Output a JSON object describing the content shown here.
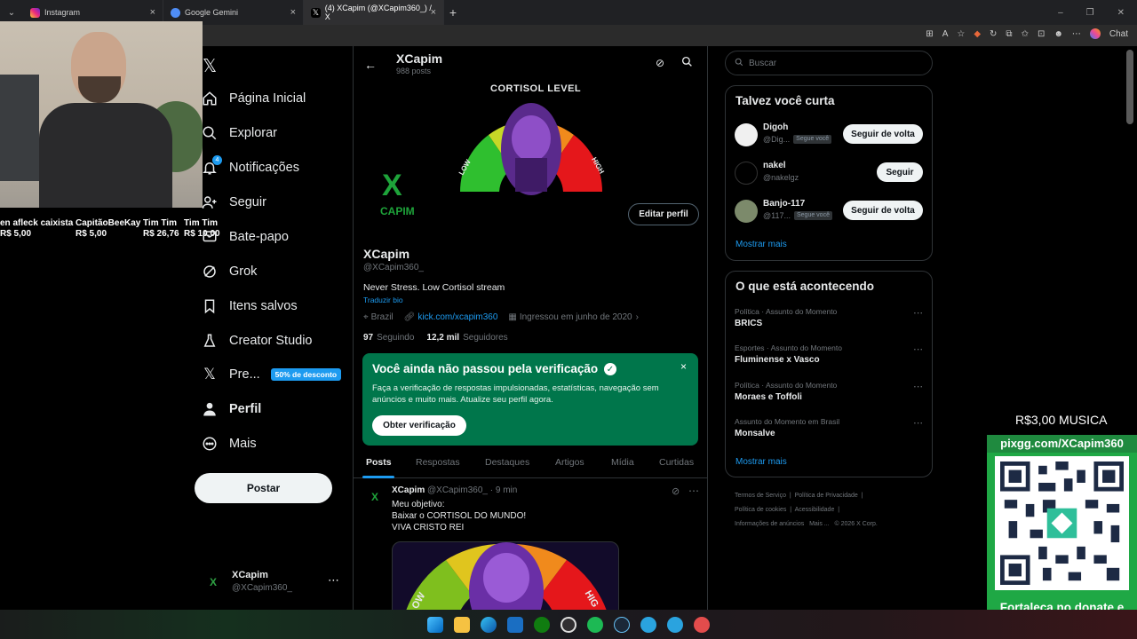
{
  "browser": {
    "tabs": [
      {
        "label": "Instagram",
        "color": "#d62976"
      },
      {
        "label": "Google Gemini",
        "color": "#4f8df5"
      },
      {
        "label": "(4) XCapim (@XCapim360_) / X",
        "color": "#ffffff"
      }
    ],
    "chat_label": "Chat"
  },
  "stream_overlay": {
    "donations": [
      {
        "name": "en afleck caixista",
        "amount": "R$ 5,00"
      },
      {
        "name": "CapitãoBeeKay",
        "amount": "R$ 5,00"
      },
      {
        "name": "Tim Tim",
        "amount": "R$ 26,76"
      },
      {
        "name": "Tim Tim",
        "amount": "R$ 10,00"
      }
    ],
    "music_price": "R$3,00 MUSICA",
    "pix_url": "pixgg.com/XCapim360",
    "donate_message": "Fortaleça no donate e envie sua mensagem!"
  },
  "nav": {
    "items": [
      {
        "label": "Página Inicial",
        "icon": "home-icon"
      },
      {
        "label": "Explorar",
        "icon": "search-icon"
      },
      {
        "label": "Notificações",
        "icon": "bell-icon",
        "badge": "4"
      },
      {
        "label": "Seguir",
        "icon": "person-add-icon"
      },
      {
        "label": "Bate-papo",
        "icon": "chat-icon"
      },
      {
        "label": "Grok",
        "icon": "grok-icon"
      },
      {
        "label": "Itens salvos",
        "icon": "bookmark-icon"
      },
      {
        "label": "Creator Studio",
        "icon": "flask-icon"
      },
      {
        "label": "Pre...",
        "icon": "x-logo-icon",
        "badge": "50% de desconto"
      },
      {
        "label": "Perfil",
        "icon": "profile-icon"
      },
      {
        "label": "Mais",
        "icon": "more-circle-icon"
      }
    ],
    "post_label": "Postar",
    "account": {
      "name": "XCapim",
      "handle": "@XCapim360_"
    }
  },
  "profile": {
    "header_name": "XCapim",
    "post_count": "988 posts",
    "banner_title": "CORTISOL LEVEL",
    "banner_low": "LOW",
    "banner_high": "HIGH",
    "avatar_text": "CAPIM",
    "edit_label": "Editar perfil",
    "name": "XCapim",
    "handle": "@XCapim360_",
    "bio": "Never Stress. Low Cortisol stream",
    "translate": "Traduzir bio",
    "location": "Brazil",
    "link": "kick.com/xcapim360",
    "joined": "Ingressou em junho de 2020",
    "following_count": "97",
    "following_label": "Seguindo",
    "followers_count": "12,2 mil",
    "followers_label": "Seguidores"
  },
  "verification": {
    "title": "Você ainda não passou pela verificação",
    "text": "Faça a verificação de respostas impulsionadas, estatísticas, navegação sem anúncios e muito mais. Atualize seu perfil agora.",
    "button": "Obter verificação",
    "color": "#00764b"
  },
  "profile_tabs": [
    "Posts",
    "Respostas",
    "Destaques",
    "Artigos",
    "Mídia",
    "Curtidas"
  ],
  "post": {
    "name": "XCapim",
    "handle": "@XCapim360_",
    "time": "· 9 min",
    "lines": [
      "Meu objetivo:",
      "Baixar o CORTISOL DO MUNDO!",
      "VIVA CRISTO REI"
    ],
    "image_low": "OW",
    "image_high": "HIG"
  },
  "right": {
    "search_placeholder": "Buscar",
    "suggest_title": "Talvez você curta",
    "suggestions": [
      {
        "name": "Digoh",
        "handle": "@Dig...",
        "tag": "Segue você",
        "button": "Seguir de volta"
      },
      {
        "name": "nakel",
        "handle": "@nakelgz",
        "tag": "",
        "button": "Seguir"
      },
      {
        "name": "Banjo-117",
        "handle": "@117...",
        "tag": "Segue você",
        "button": "Seguir de volta"
      }
    ],
    "show_more": "Mostrar mais",
    "trends_title": "O que está acontecendo",
    "trends": [
      {
        "category": "Política · Assunto do Momento",
        "name": "BRICS"
      },
      {
        "category": "Esportes · Assunto do Momento",
        "name": "Fluminense x Vasco"
      },
      {
        "category": "Política · Assunto do Momento",
        "name": "Moraes e Toffoli"
      },
      {
        "category": "Assunto do Momento em Brasil",
        "name": "Monsalve"
      }
    ],
    "trends_more": "Mostrar mais",
    "footer_links": [
      "Termos de Serviço",
      "Política de Privacidade",
      "Política de cookies",
      "Acessibilidade",
      "Informações de anúncios",
      "Mais ...",
      "© 2026 X Corp."
    ]
  }
}
